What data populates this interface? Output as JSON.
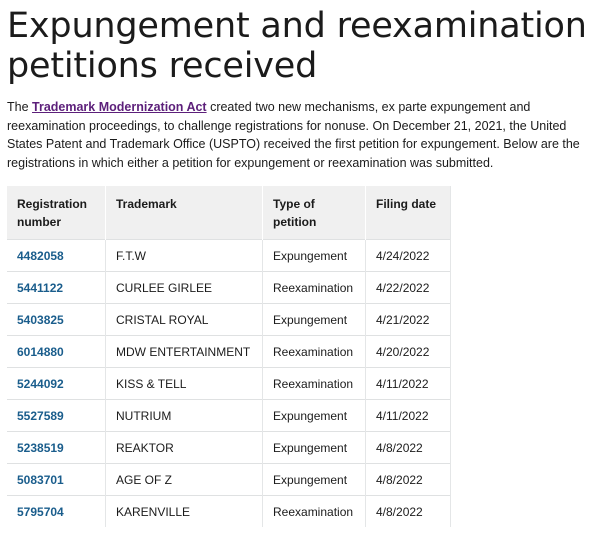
{
  "heading": "Expungement and reexamination petitions received",
  "intro": {
    "before_link": "The ",
    "link_text": "Trademark Modernization Act",
    "after_link": " created two new mechanisms, ex parte expungement and reexamination proceedings, to challenge registrations for nonuse. On December 21, 2021, the United States Patent and Trademark Office (USPTO) received the first petition for expungement. Below are the registrations in which either a petition for expungement or reexamination was submitted."
  },
  "table": {
    "headers": [
      "Registration number",
      "Trademark",
      "Type of petition",
      "Filing date"
    ],
    "rows": [
      {
        "registration": "4482058",
        "trademark": "F.T.W",
        "type": "Expungement",
        "date": "4/24/2022"
      },
      {
        "registration": "5441122",
        "trademark": "CURLEE GIRLEE",
        "type": "Reexamination",
        "date": "4/22/2022"
      },
      {
        "registration": "5403825",
        "trademark": "CRISTAL ROYAL",
        "type": "Expungement",
        "date": "4/21/2022"
      },
      {
        "registration": "6014880",
        "trademark": "MDW ENTERTAINMENT",
        "type": "Reexamination",
        "date": "4/20/2022"
      },
      {
        "registration": "5244092",
        "trademark": "KISS & TELL",
        "type": "Reexamination",
        "date": "4/11/2022"
      },
      {
        "registration": "5527589",
        "trademark": "NUTRIUM",
        "type": "Expungement",
        "date": "4/11/2022"
      },
      {
        "registration": "5238519",
        "trademark": "REAKTOR",
        "type": "Expungement",
        "date": "4/8/2022"
      },
      {
        "registration": "5083701",
        "trademark": "AGE OF Z",
        "type": "Expungement",
        "date": "4/8/2022"
      },
      {
        "registration": "5795704",
        "trademark": "KARENVILLE",
        "type": "Reexamination",
        "date": "4/8/2022"
      }
    ]
  }
}
